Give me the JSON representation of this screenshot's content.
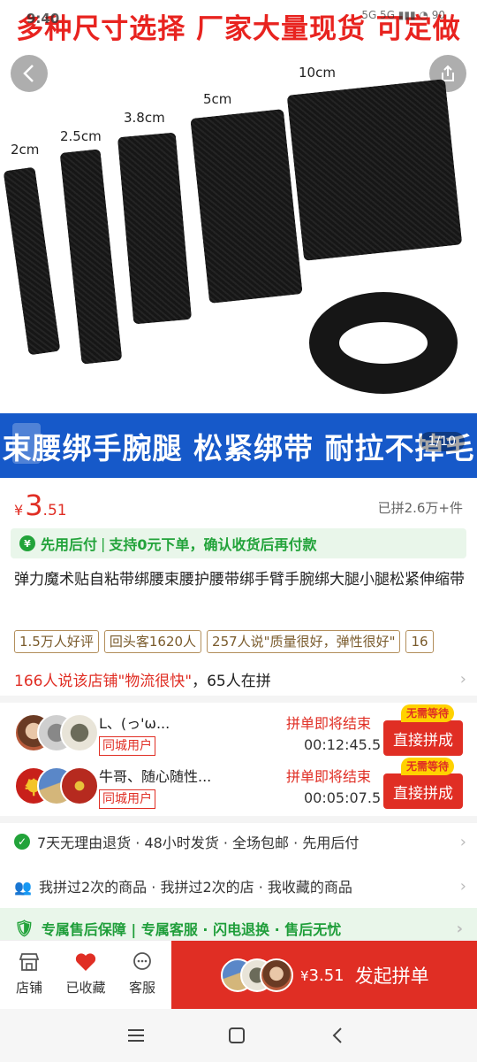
{
  "status_bar": {
    "time": "9:40",
    "right": "5G 5G ▮▮▮ ◔ 90"
  },
  "hero": {
    "top_banner": "多种尺寸选择 厂家大量现货 可定做",
    "bottom_banner": "束腰绑手腕腿 松紧绑带 耐拉不掉毛",
    "image_counter": "1/10",
    "sizes": [
      "2cm",
      "2.5cm",
      "3.8cm",
      "5cm",
      "10cm"
    ]
  },
  "price": {
    "currency": "¥",
    "integer": "3",
    "decimal": ".51",
    "sold": "已拼2.6万+件"
  },
  "paylater": {
    "label": "先用后付",
    "separator": "|",
    "desc": "支持0元下单，确认收货后再付款"
  },
  "product": {
    "title": "弹力魔术贴自粘带绑腰束腰护腰带绑手臂手腕绑大腿小腿松紧伸缩带"
  },
  "tags": [
    "1.5万人好评",
    "回头客1620人",
    "257人说\"质量很好，弹性很好\"",
    "16"
  ],
  "logistics": {
    "highlight": "166人说该店铺\"物流很快\"",
    "rest": "，65人在拼"
  },
  "groups": [
    {
      "name": "L、(っ'ω...",
      "badge": "同城用户",
      "status": "拼单即将结束",
      "time": "00:12:45.5",
      "button": "直接拼成",
      "tip": "无需等待"
    },
    {
      "name": "牛哥、随心随性...",
      "badge": "同城用户",
      "status": "拼单即将结束",
      "time": "00:05:07.5",
      "button": "直接拼成",
      "tip": "无需等待"
    }
  ],
  "service": "7天无理由退货 · 48小时发货 · 全场包邮 · 先用后付",
  "history": "我拼过2次的商品 · 我拼过2次的店 · 我收藏的商品",
  "guarantee": "专属售后保障 | 专属客服 · 闪电退换 · 售后无忧",
  "actions": {
    "store": "店铺",
    "fav": "已收藏",
    "service": "客服"
  },
  "buy": {
    "currency": "¥",
    "price": "3.51",
    "label": "发起拼单"
  },
  "colors": {
    "accent": "#e02e24",
    "green": "#22a33a",
    "banner_blue": "#1659c9"
  }
}
